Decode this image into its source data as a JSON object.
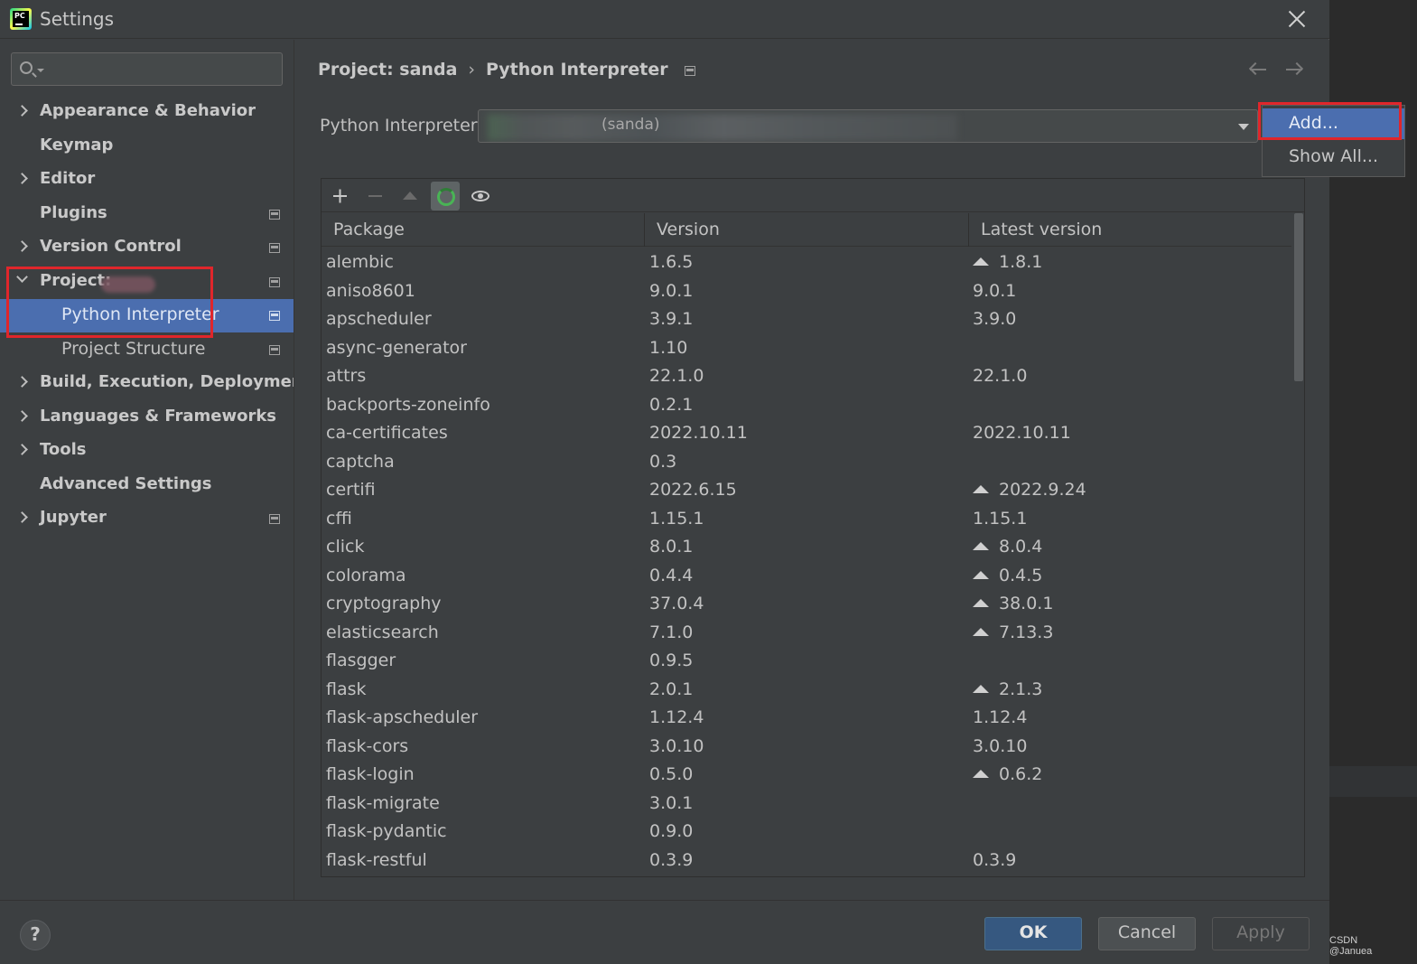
{
  "window": {
    "title": "Settings"
  },
  "search": {
    "placeholder": ""
  },
  "sidebar": {
    "items": [
      {
        "label": "Appearance & Behavior",
        "bold": true,
        "chevron": "right"
      },
      {
        "label": "Keymap",
        "bold": true,
        "chevron": "none"
      },
      {
        "label": "Editor",
        "bold": true,
        "chevron": "right"
      },
      {
        "label": "Plugins",
        "bold": true,
        "chevron": "none",
        "project_icon": true
      },
      {
        "label": "Version Control",
        "bold": true,
        "chevron": "right",
        "project_icon": true
      },
      {
        "label": "Project:",
        "bold": true,
        "chevron": "down",
        "project_icon": true
      },
      {
        "label": "Python Interpreter",
        "bold": false,
        "chevron": "none",
        "project_icon": true,
        "selected": true
      },
      {
        "label": "Project Structure",
        "bold": false,
        "chevron": "none",
        "project_icon": true
      },
      {
        "label": "Build, Execution, Deployment",
        "bold": true,
        "chevron": "right"
      },
      {
        "label": "Languages & Frameworks",
        "bold": true,
        "chevron": "right"
      },
      {
        "label": "Tools",
        "bold": true,
        "chevron": "right"
      },
      {
        "label": "Advanced Settings",
        "bold": true,
        "chevron": "none"
      },
      {
        "label": "Jupyter",
        "bold": true,
        "chevron": "right",
        "project_icon": true
      }
    ]
  },
  "breadcrumb": {
    "project": "Project: sanda",
    "separator": "›",
    "page": "Python Interpreter"
  },
  "interpreter": {
    "label": "Python Interpreter:",
    "value": "(sanda)",
    "menu": [
      "Add...",
      "Show All..."
    ]
  },
  "toolbar": {
    "icons": [
      "plus-icon",
      "minus-icon",
      "upgrade-icon",
      "refresh-icon",
      "eye-icon"
    ]
  },
  "table": {
    "columns": [
      "Package",
      "Version",
      "Latest version"
    ],
    "rows": [
      [
        "alembic",
        "1.6.5",
        "1.8.1",
        true
      ],
      [
        "aniso8601",
        "9.0.1",
        "9.0.1",
        false
      ],
      [
        "apscheduler",
        "3.9.1",
        "3.9.0",
        false
      ],
      [
        "async-generator",
        "1.10",
        "",
        false
      ],
      [
        "attrs",
        "22.1.0",
        "22.1.0",
        false
      ],
      [
        "backports-zoneinfo",
        "0.2.1",
        "",
        false
      ],
      [
        "ca-certificates",
        "2022.10.11",
        "2022.10.11",
        false
      ],
      [
        "captcha",
        "0.3",
        "",
        false
      ],
      [
        "certifi",
        "2022.6.15",
        "2022.9.24",
        true
      ],
      [
        "cffi",
        "1.15.1",
        "1.15.1",
        false
      ],
      [
        "click",
        "8.0.1",
        "8.0.4",
        true
      ],
      [
        "colorama",
        "0.4.4",
        "0.4.5",
        true
      ],
      [
        "cryptography",
        "37.0.4",
        "38.0.1",
        true
      ],
      [
        "elasticsearch",
        "7.1.0",
        "7.13.3",
        true
      ],
      [
        "flasgger",
        "0.9.5",
        "",
        false
      ],
      [
        "flask",
        "2.0.1",
        "2.1.3",
        true
      ],
      [
        "flask-apscheduler",
        "1.12.4",
        "1.12.4",
        false
      ],
      [
        "flask-cors",
        "3.0.10",
        "3.0.10",
        false
      ],
      [
        "flask-login",
        "0.5.0",
        "0.6.2",
        true
      ],
      [
        "flask-migrate",
        "3.0.1",
        "",
        false
      ],
      [
        "flask-pydantic",
        "0.9.0",
        "",
        false
      ],
      [
        "flask-restful",
        "0.3.9",
        "0.3.9",
        false
      ]
    ]
  },
  "footer": {
    "help": "?",
    "ok": "OK",
    "cancel": "Cancel",
    "apply": "Apply"
  },
  "watermark": "CSDN @Januea",
  "colors": {
    "selection": "#4b6eaf",
    "highlight": "#e0262b",
    "ok_button": "#365880"
  }
}
